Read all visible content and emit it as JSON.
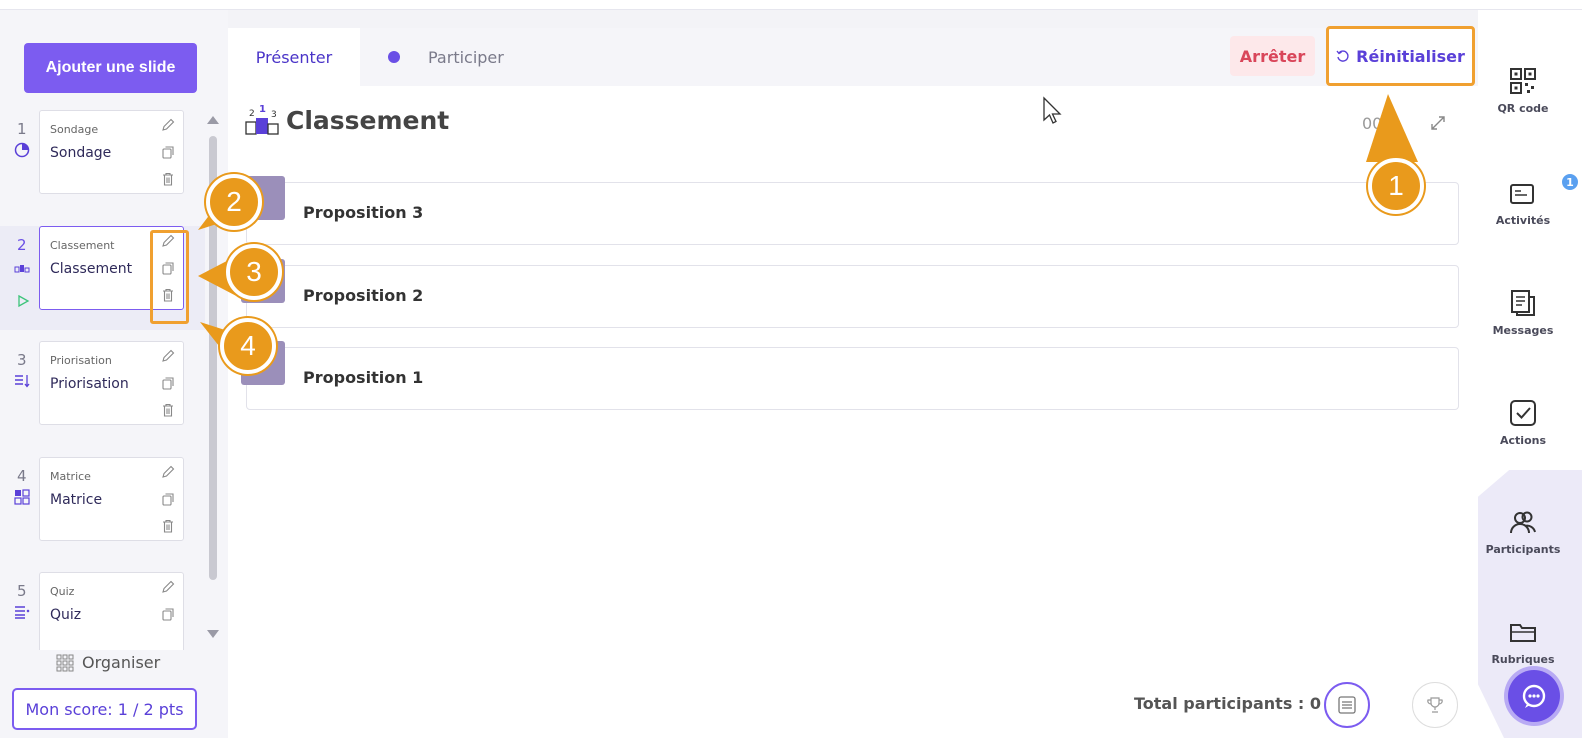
{
  "sidebar": {
    "add_slide_label": "Ajouter une slide",
    "slides": [
      {
        "num": "1",
        "type": "Sondage",
        "title": "Sondage"
      },
      {
        "num": "2",
        "type": "Classement",
        "title": "Classement"
      },
      {
        "num": "3",
        "type": "Priorisation",
        "title": "Priorisation"
      },
      {
        "num": "4",
        "type": "Matrice",
        "title": "Matrice"
      },
      {
        "num": "5",
        "type": "Quiz",
        "title": "Quiz"
      }
    ],
    "organiser_label": "Organiser",
    "score_label": "Mon score: 1 / 2 pts"
  },
  "tabs": {
    "present_label": "Présenter",
    "participate_label": "Participer"
  },
  "toolbar": {
    "stop_label": "Arrêter",
    "reset_label": "Réinitialiser"
  },
  "content": {
    "title": "Classement",
    "timer": "00:",
    "propositions": [
      "Proposition 3",
      "Proposition 2",
      "Proposition 1"
    ],
    "total_participants": "Total participants : 0"
  },
  "rail": {
    "qr_label": "QR code",
    "activities_label": "Activités",
    "activities_badge": "1",
    "messages_label": "Messages",
    "actions_label": "Actions",
    "participants_label": "Participants",
    "rubriques_label": "Rubriques"
  },
  "callouts": [
    "1",
    "2",
    "3",
    "4"
  ],
  "colors": {
    "accent": "#7c5cf0",
    "highlight": "#f0a030",
    "stop": "#d9465a",
    "badge": "#9b8fba"
  }
}
